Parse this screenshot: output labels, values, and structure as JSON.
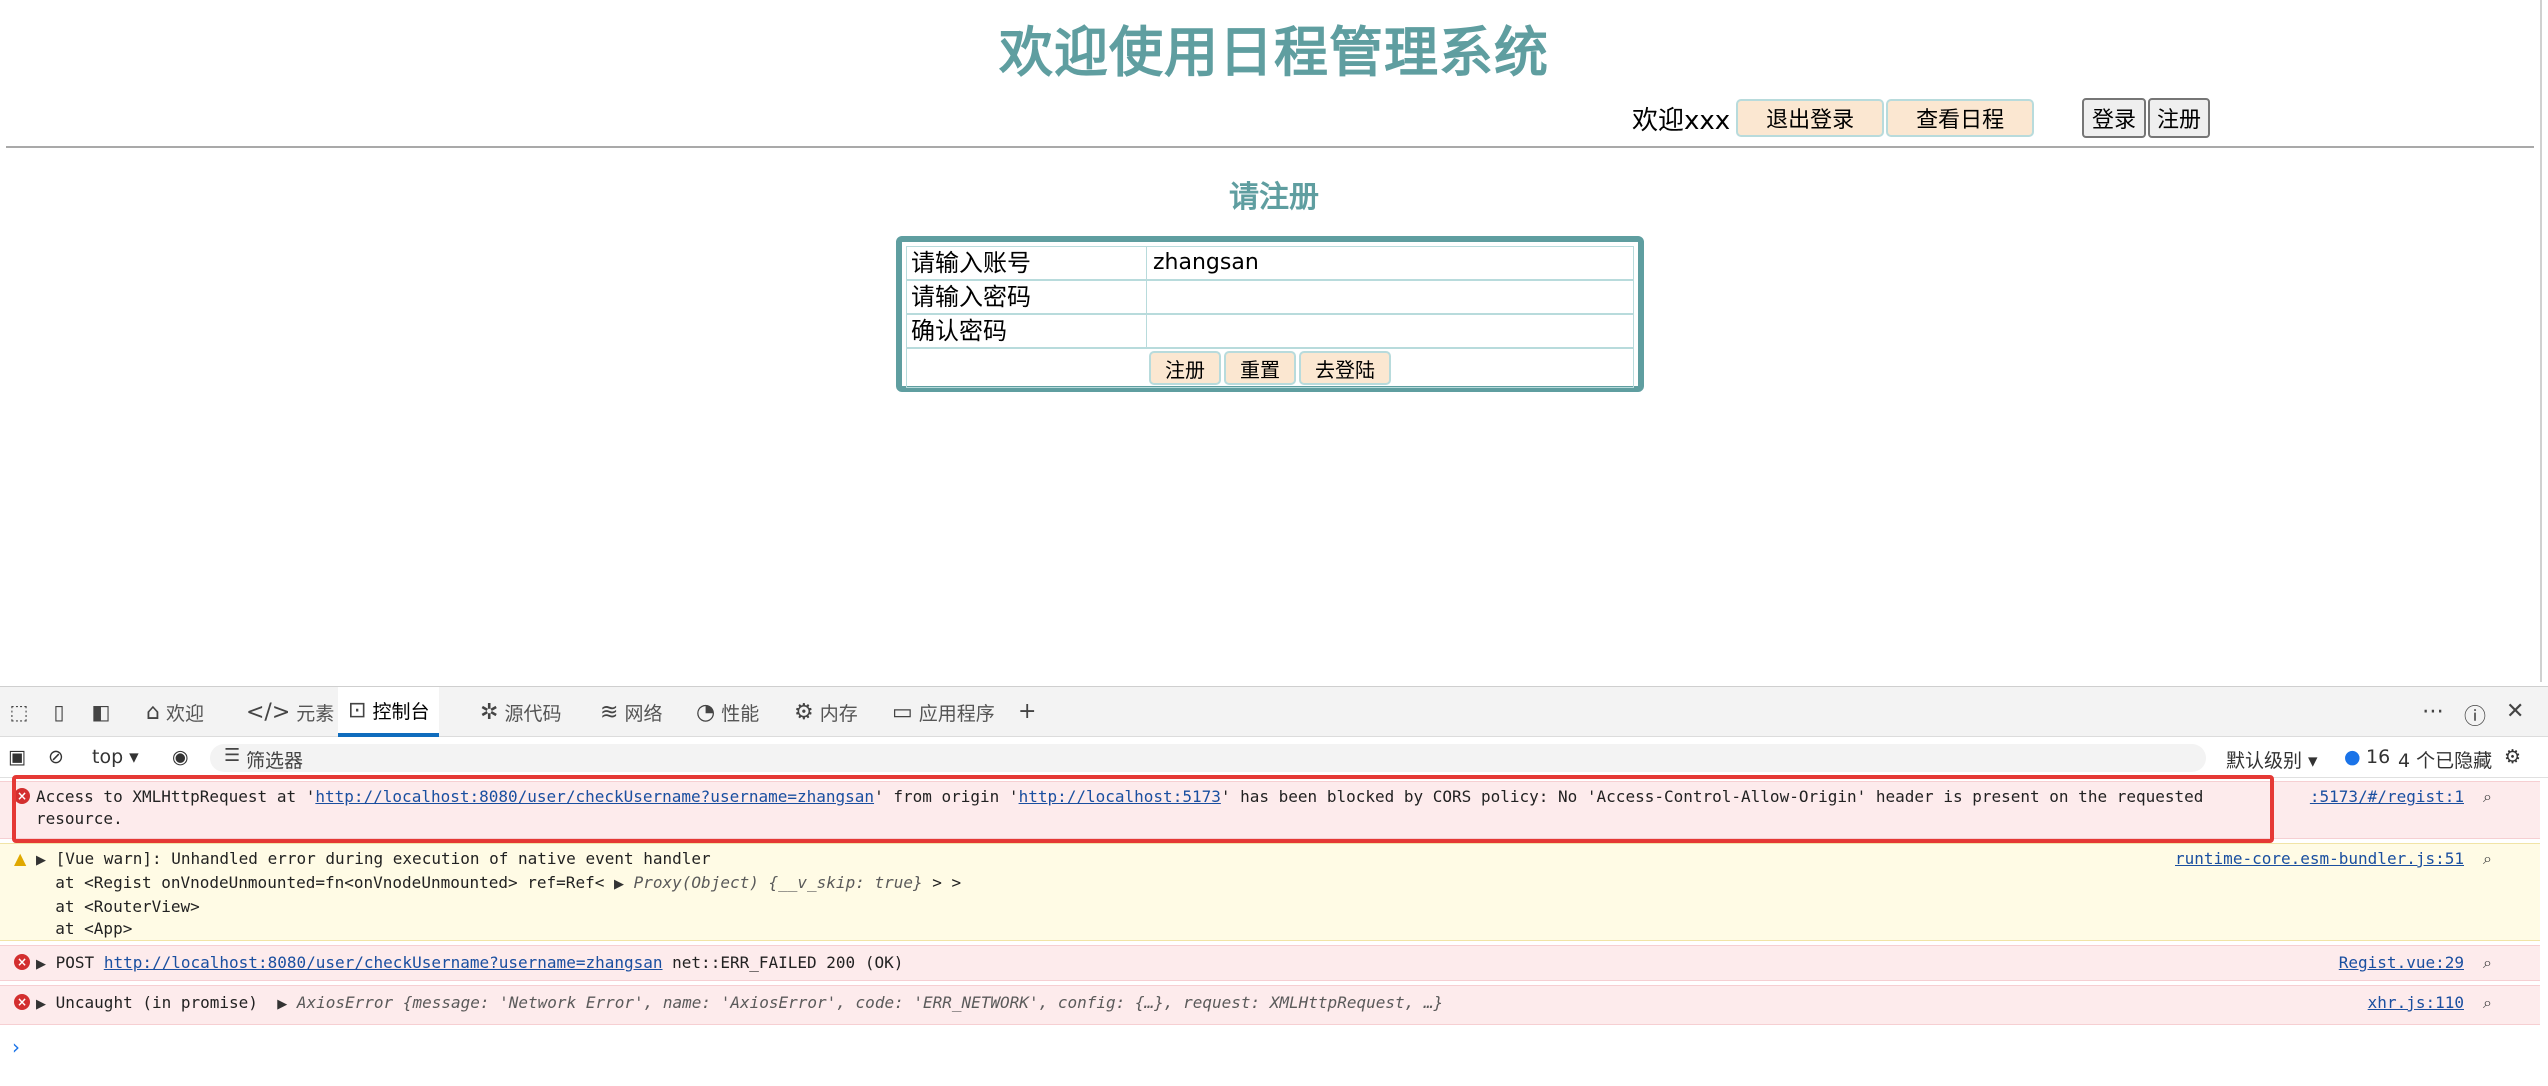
{
  "page": {
    "title": "欢迎使用日程管理系统",
    "welcome": "欢迎xxx",
    "logout_label": "退出登录",
    "schedule_label": "查看日程",
    "login_label": "登录",
    "register_label": "注册",
    "subtitle": "请注册"
  },
  "form": {
    "username_label": "请输入账号",
    "username_value": "zhangsan",
    "password_label": "请输入密码",
    "password_value": "",
    "confirm_label": "确认密码",
    "confirm_value": "",
    "submit_label": "注册",
    "reset_label": "重置",
    "goto_login_label": "去登陆"
  },
  "devtools": {
    "tabs": [
      {
        "label": "欢迎",
        "icon": "home-icon"
      },
      {
        "label": "元素",
        "icon": "code-icon"
      },
      {
        "label": "控制台",
        "icon": "console-icon"
      },
      {
        "label": "源代码",
        "icon": "bug-icon"
      },
      {
        "label": "网络",
        "icon": "wifi-icon"
      },
      {
        "label": "性能",
        "icon": "gauge-icon"
      },
      {
        "label": "内存",
        "icon": "chip-icon"
      },
      {
        "label": "应用程序",
        "icon": "app-icon"
      }
    ],
    "active_tab": "控制台",
    "context": "top",
    "filter_placeholder": "筛选器",
    "levels": "默认级别",
    "issue_count": "16",
    "hidden_count": "4 个已隐藏",
    "messages": {
      "cors": {
        "prefix": "Access to XMLHttpRequest at '",
        "url1": "http://localhost:8080/user/checkUsername?username=zhangsan",
        "mid": "' from origin '",
        "url2": "http://localhost:5173",
        "suffix": "' has been blocked by CORS policy: No 'Access-Control-Allow-Origin' header is present on the requested resource.",
        "source": ":5173/#/regist:1"
      },
      "vue_warn": {
        "line1": "[Vue warn]: Unhandled error during execution of native event handler",
        "line2a": "at <Regist onVnodeUnmounted=fn<onVnodeUnmounted> ref=Ref<",
        "line2b": "Proxy(Object)",
        "line2c": "{__v_skip: true}",
        "line2d": "> >",
        "line3": "at <RouterView>",
        "line4": "at <App>",
        "source": "runtime-core.esm-bundler.js:51"
      },
      "post": {
        "method": "POST",
        "url": "http://localhost:8080/user/checkUsername?username=zhangsan",
        "status": "net::ERR_FAILED 200 (OK)",
        "source": "Regist.vue:29"
      },
      "uncaught": {
        "prefix": "Uncaught (in promise)",
        "detail": "AxiosError {message: 'Network Error', name: 'AxiosError', code: 'ERR_NETWORK', config: {…}, request: XMLHttpRequest, …}",
        "source": "xhr.js:110"
      }
    },
    "accent_color": "#0f6cbd"
  }
}
